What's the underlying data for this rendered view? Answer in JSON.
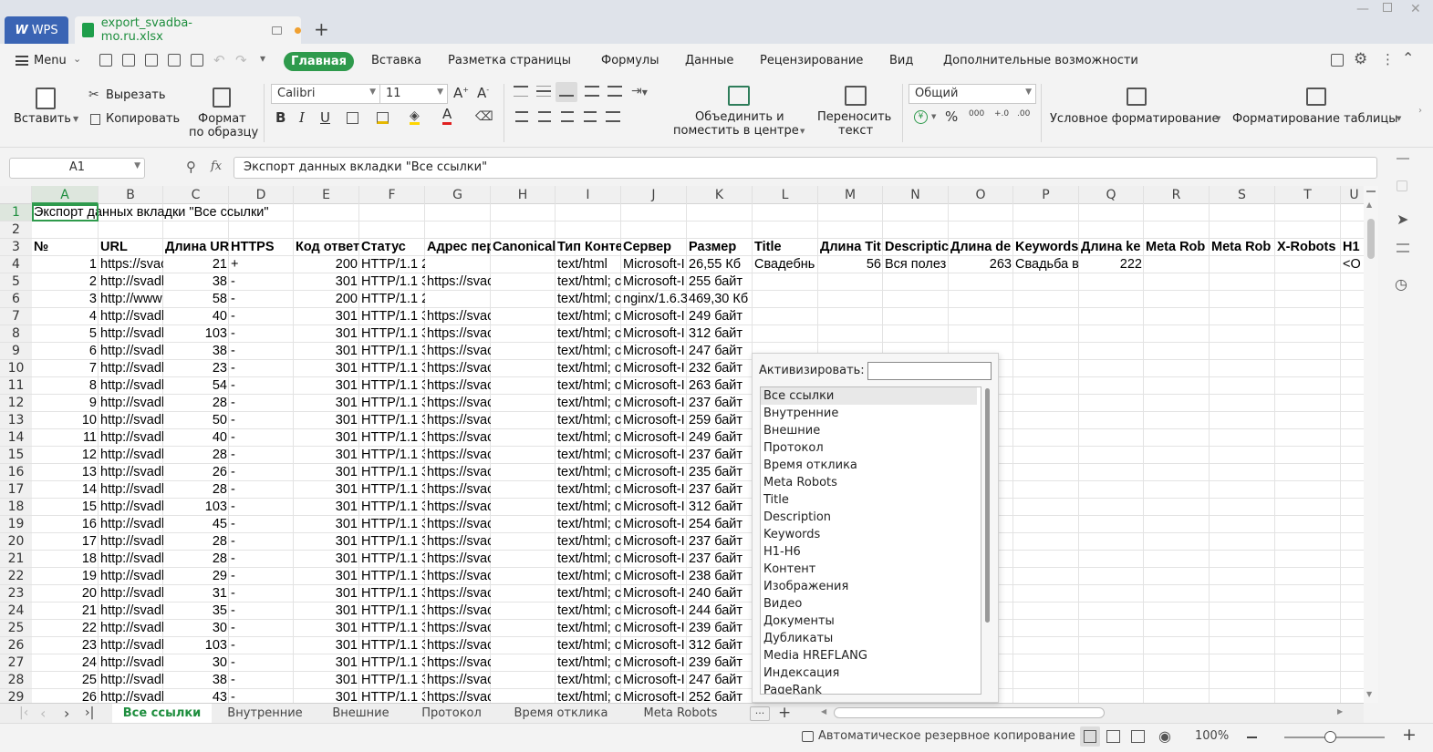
{
  "titlebar": {
    "app_tab": "WPS",
    "file_tab": "export_svadba-mo.ru.xlsx",
    "new_tab": "+"
  },
  "menu": {
    "menu_label": "Menu",
    "tabs": [
      "Главная",
      "Вставка",
      "Разметка страницы",
      "Формулы",
      "Данные",
      "Рецензирование",
      "Вид",
      "Дополнительные возможности"
    ]
  },
  "ribbon": {
    "paste": "Вставить",
    "cut": "Вырезать",
    "copy": "Копировать",
    "format_painter_1": "Формат",
    "format_painter_2": "по образцу",
    "font_name": "Calibri",
    "font_size": "11",
    "merge_1": "Объединить и",
    "merge_2": "поместить в центре",
    "wrap_1": "Переносить",
    "wrap_2": "текст",
    "number_format": "Общий",
    "cond_format": "Условное форматирование",
    "table_format": "Форматирование таблицы"
  },
  "formula_bar": {
    "name_box": "A1",
    "fx": "fx",
    "content": "Экспорт данных вкладки \"Все ссылки\""
  },
  "grid": {
    "columns": [
      "A",
      "B",
      "C",
      "D",
      "E",
      "F",
      "G",
      "H",
      "I",
      "J",
      "K",
      "L",
      "M",
      "N",
      "O",
      "P",
      "Q",
      "R",
      "S",
      "T",
      "U"
    ],
    "rows": [
      "1",
      "2",
      "3",
      "4",
      "5",
      "6",
      "7",
      "8",
      "9",
      "10",
      "11",
      "12",
      "13",
      "14",
      "15",
      "16",
      "17",
      "18",
      "19",
      "20",
      "21",
      "22",
      "23",
      "24",
      "25",
      "26",
      "27",
      "28",
      "29"
    ],
    "a1": "Экспорт данных вкладки \"Все ссылки\"",
    "headers": [
      "№",
      "URL",
      "Длина UR",
      "HTTPS",
      "Код ответ",
      "Статус",
      "Адрес пер",
      "Canonical",
      "Тип Конте",
      "Сервер",
      "Размер",
      "Title",
      "Длина Tit",
      "Descriptic",
      "Длина de",
      "Keywords",
      "Длина ke",
      "Meta Rob",
      "Meta Rob",
      "X-Robots",
      "H1"
    ],
    "data": [
      [
        "1",
        "https://svac",
        "21",
        "+",
        "200",
        "HTTP/1.1 2",
        "",
        "",
        "text/html",
        "Microsoft-I",
        "26,55 Кб",
        "Свадебнь",
        "56",
        "Вся полез",
        "263",
        "Свадьба в",
        "222",
        "",
        "",
        "",
        "<O"
      ],
      [
        "2",
        "http://svadl",
        "38",
        "-",
        "301",
        "HTTP/1.1 3",
        "https://svac",
        "",
        "text/html; c",
        "Microsoft-I",
        "255 байт",
        "",
        "",
        "",
        "",
        "",
        "",
        "",
        "",
        "",
        ""
      ],
      [
        "3",
        "http://www",
        "58",
        "-",
        "200",
        "HTTP/1.1 2",
        "",
        "",
        "text/html; c",
        "nginx/1.6.3",
        "469,30 Кб",
        "",
        "",
        "",
        "",
        "",
        "",
        "",
        "",
        "",
        ""
      ],
      [
        "4",
        "http://svadl",
        "40",
        "-",
        "301",
        "HTTP/1.1 3",
        "https://svac",
        "",
        "text/html; c",
        "Microsoft-I",
        "249 байт",
        "",
        "",
        "",
        "",
        "",
        "",
        "",
        "",
        "",
        ""
      ],
      [
        "5",
        "http://svadl",
        "103",
        "-",
        "301",
        "HTTP/1.1 3",
        "https://svac",
        "",
        "text/html; c",
        "Microsoft-I",
        "312 байт",
        "",
        "",
        "",
        "",
        "",
        "",
        "",
        "",
        "",
        ""
      ],
      [
        "6",
        "http://svadl",
        "38",
        "-",
        "301",
        "HTTP/1.1 3",
        "https://svac",
        "",
        "text/html; c",
        "Microsoft-I",
        "247 байт",
        "",
        "",
        "",
        "",
        "",
        "",
        "",
        "",
        "",
        ""
      ],
      [
        "7",
        "http://svadl",
        "23",
        "-",
        "301",
        "HTTP/1.1 3",
        "https://svac",
        "",
        "text/html; c",
        "Microsoft-I",
        "232 байт",
        "",
        "",
        "",
        "",
        "",
        "",
        "",
        "",
        "",
        ""
      ],
      [
        "8",
        "http://svadl",
        "54",
        "-",
        "301",
        "HTTP/1.1 3",
        "https://svac",
        "",
        "text/html; c",
        "Microsoft-I",
        "263 байт",
        "",
        "",
        "",
        "",
        "",
        "",
        "",
        "",
        "",
        ""
      ],
      [
        "9",
        "http://svadl",
        "28",
        "-",
        "301",
        "HTTP/1.1 3",
        "https://svac",
        "",
        "text/html; c",
        "Microsoft-I",
        "237 байт",
        "",
        "",
        "",
        "",
        "",
        "",
        "",
        "",
        "",
        ""
      ],
      [
        "10",
        "http://svadl",
        "50",
        "-",
        "301",
        "HTTP/1.1 3",
        "https://svac",
        "",
        "text/html; c",
        "Microsoft-I",
        "259 байт",
        "",
        "",
        "",
        "",
        "",
        "",
        "",
        "",
        "",
        ""
      ],
      [
        "11",
        "http://svadl",
        "40",
        "-",
        "301",
        "HTTP/1.1 3",
        "https://svac",
        "",
        "text/html; c",
        "Microsoft-I",
        "249 байт",
        "",
        "",
        "",
        "",
        "",
        "",
        "",
        "",
        "",
        ""
      ],
      [
        "12",
        "http://svadl",
        "28",
        "-",
        "301",
        "HTTP/1.1 3",
        "https://svac",
        "",
        "text/html; c",
        "Microsoft-I",
        "237 байт",
        "",
        "",
        "",
        "",
        "",
        "",
        "",
        "",
        "",
        ""
      ],
      [
        "13",
        "http://svadl",
        "26",
        "-",
        "301",
        "HTTP/1.1 3",
        "https://svac",
        "",
        "text/html; c",
        "Microsoft-I",
        "235 байт",
        "",
        "",
        "",
        "",
        "",
        "",
        "",
        "",
        "",
        ""
      ],
      [
        "14",
        "http://svadl",
        "28",
        "-",
        "301",
        "HTTP/1.1 3",
        "https://svac",
        "",
        "text/html; c",
        "Microsoft-I",
        "237 байт",
        "",
        "",
        "",
        "",
        "",
        "",
        "",
        "",
        "",
        ""
      ],
      [
        "15",
        "http://svadl",
        "103",
        "-",
        "301",
        "HTTP/1.1 3",
        "https://svac",
        "",
        "text/html; c",
        "Microsoft-I",
        "312 байт",
        "",
        "",
        "",
        "",
        "",
        "",
        "",
        "",
        "",
        ""
      ],
      [
        "16",
        "http://svadl",
        "45",
        "-",
        "301",
        "HTTP/1.1 3",
        "https://svac",
        "",
        "text/html; c",
        "Microsoft-I",
        "254 байт",
        "",
        "",
        "",
        "",
        "",
        "",
        "",
        "",
        "",
        ""
      ],
      [
        "17",
        "http://svadl",
        "28",
        "-",
        "301",
        "HTTP/1.1 3",
        "https://svac",
        "",
        "text/html; c",
        "Microsoft-I",
        "237 байт",
        "",
        "",
        "",
        "",
        "",
        "",
        "",
        "",
        "",
        ""
      ],
      [
        "18",
        "http://svadl",
        "28",
        "-",
        "301",
        "HTTP/1.1 3",
        "https://svac",
        "",
        "text/html; c",
        "Microsoft-I",
        "237 байт",
        "",
        "",
        "",
        "",
        "",
        "",
        "",
        "",
        "",
        ""
      ],
      [
        "19",
        "http://svadl",
        "29",
        "-",
        "301",
        "HTTP/1.1 3",
        "https://svac",
        "",
        "text/html; c",
        "Microsoft-I",
        "238 байт",
        "",
        "",
        "",
        "",
        "",
        "",
        "",
        "",
        "",
        ""
      ],
      [
        "20",
        "http://svadl",
        "31",
        "-",
        "301",
        "HTTP/1.1 3",
        "https://svac",
        "",
        "text/html; c",
        "Microsoft-I",
        "240 байт",
        "",
        "",
        "",
        "",
        "",
        "",
        "",
        "",
        "",
        ""
      ],
      [
        "21",
        "http://svadl",
        "35",
        "-",
        "301",
        "HTTP/1.1 3",
        "https://svac",
        "",
        "text/html; c",
        "Microsoft-I",
        "244 байт",
        "",
        "",
        "",
        "",
        "",
        "",
        "",
        "",
        "",
        ""
      ],
      [
        "22",
        "http://svadl",
        "30",
        "-",
        "301",
        "HTTP/1.1 3",
        "https://svac",
        "",
        "text/html; c",
        "Microsoft-I",
        "239 байт",
        "",
        "",
        "",
        "",
        "",
        "",
        "",
        "",
        "",
        ""
      ],
      [
        "23",
        "http://svadl",
        "103",
        "-",
        "301",
        "HTTP/1.1 3",
        "https://svac",
        "",
        "text/html; c",
        "Microsoft-I",
        "312 байт",
        "",
        "",
        "",
        "",
        "",
        "",
        "",
        "",
        "",
        ""
      ],
      [
        "24",
        "http://svadl",
        "30",
        "-",
        "301",
        "HTTP/1.1 3",
        "https://svac",
        "",
        "text/html; c",
        "Microsoft-I",
        "239 байт",
        "",
        "",
        "",
        "",
        "",
        "",
        "",
        "",
        "",
        ""
      ],
      [
        "25",
        "http://svadl",
        "38",
        "-",
        "301",
        "HTTP/1.1 3",
        "https://svac",
        "",
        "text/html; c",
        "Microsoft-I",
        "247 байт",
        "",
        "",
        "",
        "",
        "",
        "",
        "",
        "",
        "",
        ""
      ],
      [
        "26",
        "http://svadl",
        "43",
        "-",
        "301",
        "HTTP/1.1 3",
        "https://svac",
        "",
        "text/html; c",
        "Microsoft-I",
        "252 байт",
        "",
        "",
        "",
        "",
        "",
        "",
        "",
        "",
        "",
        ""
      ]
    ]
  },
  "sheet_tabs": [
    "Все ссылки",
    "Внутренние",
    "Внешние",
    "Протокол",
    "Время отклика",
    "Meta Robots"
  ],
  "sheet_more": "···",
  "statusbar": {
    "autosave": "Автоматическое резервное копирование",
    "zoom": "100%"
  },
  "popup": {
    "label": "Активизировать:",
    "input_value": "",
    "items": [
      "Все ссылки",
      "Внутренние",
      "Внешние",
      "Протокол",
      "Время отклика",
      "Meta Robots",
      "Title",
      "Description",
      "Keywords",
      "H1-H6",
      "Контент",
      "Изображения",
      "Видео",
      "Документы",
      "Дубликаты",
      "Media  HREFLANG",
      "Индексация",
      "PageRank"
    ],
    "selected_index": 0
  },
  "colors": {
    "accent_green": "#2e9a4c",
    "wps_blue": "#3a64b4",
    "tab_orange": "#f0a030"
  }
}
